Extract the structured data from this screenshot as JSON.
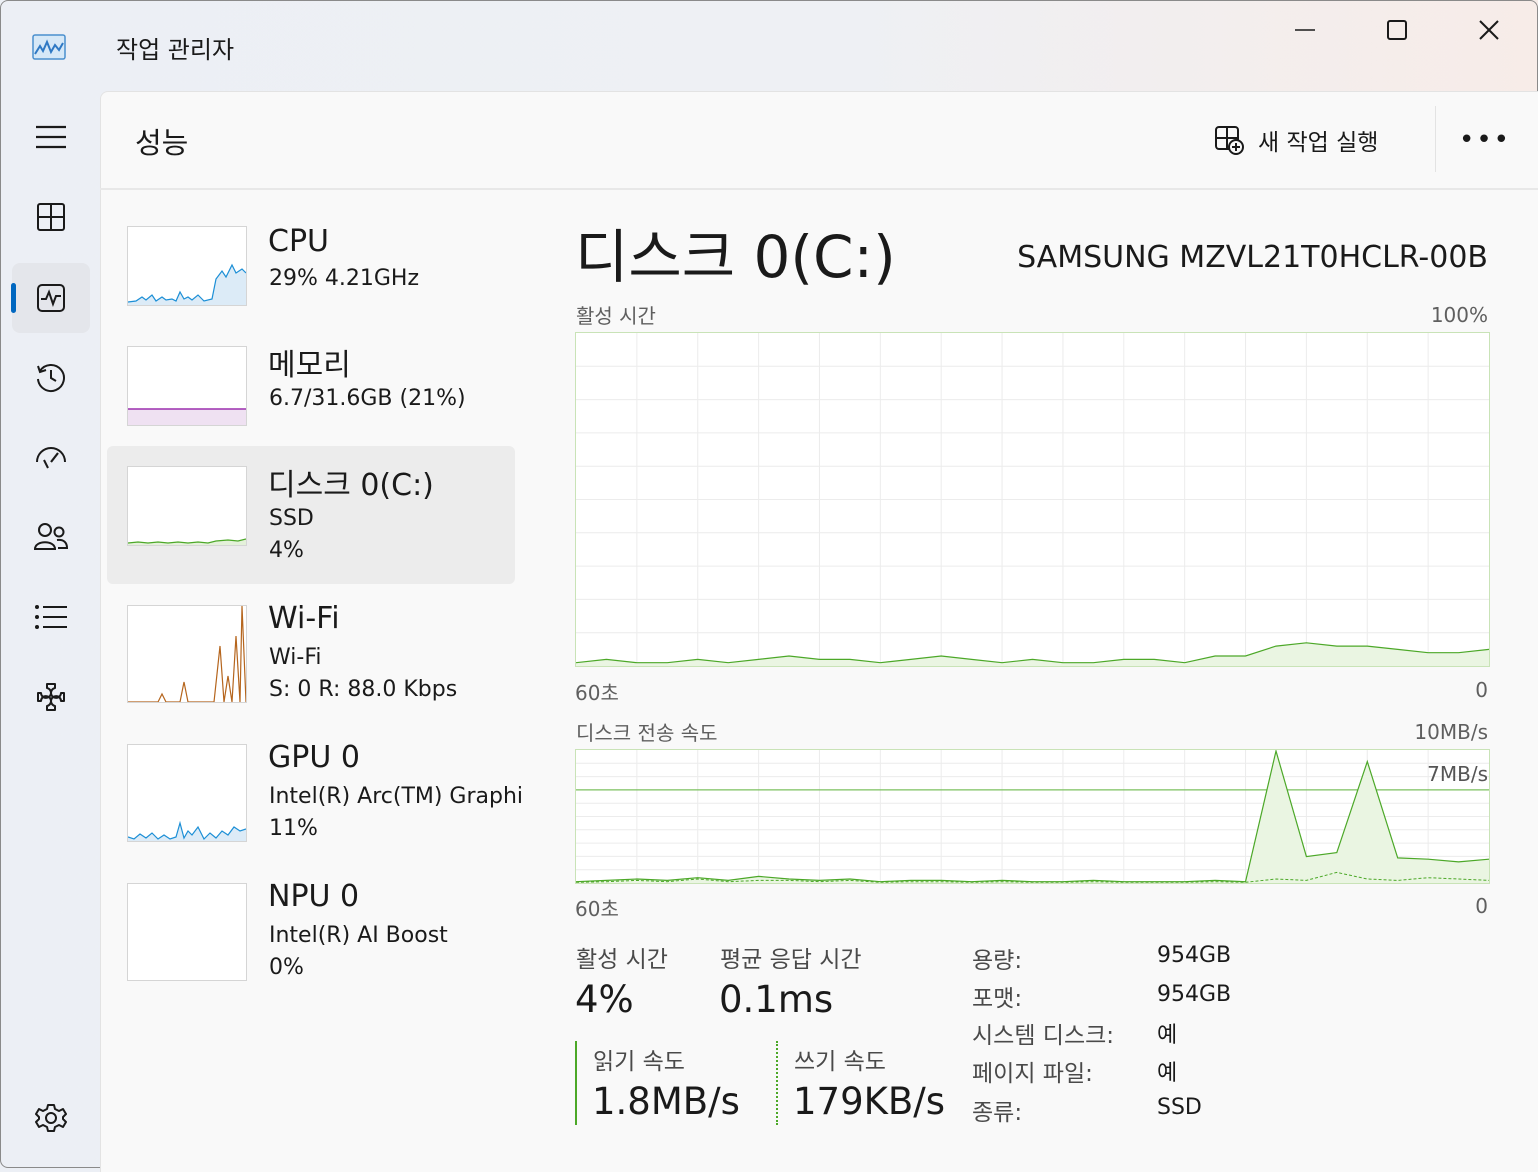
{
  "app": {
    "title": "작업 관리자"
  },
  "header": {
    "page_title": "성능",
    "run_task_label": "새 작업 실행",
    "more_label": "•••"
  },
  "nav": {
    "items": [
      {
        "name": "menu-icon"
      },
      {
        "name": "processes-icon"
      },
      {
        "name": "performance-icon",
        "active": true
      },
      {
        "name": "app-history-icon"
      },
      {
        "name": "startup-apps-icon"
      },
      {
        "name": "users-icon"
      },
      {
        "name": "details-icon"
      },
      {
        "name": "services-icon"
      },
      {
        "name": "settings-icon"
      }
    ]
  },
  "devices": [
    {
      "name": "CPU",
      "line1": "29%  4.21GHz",
      "line2": "",
      "color": "#1c8fd6"
    },
    {
      "name": "메모리",
      "line1": "6.7/31.6GB (21%)",
      "line2": "",
      "color": "#9b2fae"
    },
    {
      "name": "디스크 0(C:)",
      "line1": "SSD",
      "line2": "4%",
      "color": "#4ca828",
      "selected": true
    },
    {
      "name": "Wi-Fi",
      "line1": "Wi-Fi",
      "line2": "S: 0  R: 88.0 Kbps",
      "color": "#b5651d"
    },
    {
      "name": "GPU 0",
      "line1": "Intel(R) Arc(TM) Graphics",
      "line2": "11%",
      "color": "#1c8fd6"
    },
    {
      "name": "NPU 0",
      "line1": "Intel(R) AI Boost",
      "line2": "0%",
      "color": "#1c8fd6"
    }
  ],
  "detail": {
    "title": "디스크 0(C:)",
    "model": "SAMSUNG MZVL21T0HCLR-00B",
    "active_chart": {
      "label": "활성 시간",
      "max": "100%",
      "x_left": "60초",
      "x_right": "0"
    },
    "transfer_chart": {
      "label": "디스크 전송 속도",
      "max": "10MB/s",
      "line_label": "7MB/s",
      "x_left": "60초",
      "x_right": "0"
    },
    "stats": {
      "active_time_label": "활성 시간",
      "active_time_value": "4%",
      "response_label": "평균 응답 시간",
      "response_value": "0.1ms",
      "read_label": "읽기 속도",
      "read_value": "1.8MB/s",
      "write_label": "쓰기 속도",
      "write_value": "179KB/s"
    },
    "properties": [
      {
        "key": "용량:",
        "value": "954GB"
      },
      {
        "key": "포맷:",
        "value": "954GB"
      },
      {
        "key": "시스템 디스크:",
        "value": "예"
      },
      {
        "key": "페이지 파일:",
        "value": "예"
      },
      {
        "key": "종류:",
        "value": "SSD"
      }
    ]
  },
  "chart_data": [
    {
      "type": "area",
      "title": "활성 시간",
      "xlabel": "60초 → 0",
      "ylim": [
        0,
        100
      ],
      "x": [
        60,
        58,
        56,
        54,
        52,
        50,
        48,
        46,
        44,
        42,
        40,
        38,
        36,
        34,
        32,
        30,
        28,
        26,
        24,
        22,
        20,
        18,
        16,
        14,
        12,
        10,
        8,
        6,
        4,
        2,
        0
      ],
      "series": [
        {
          "values": [
            1,
            2,
            1,
            1,
            2,
            1,
            2,
            3,
            2,
            2,
            1,
            2,
            3,
            2,
            1,
            2,
            1,
            1,
            2,
            2,
            1,
            3,
            3,
            6,
            7,
            6,
            6,
            5,
            4,
            4,
            5
          ]
        }
      ]
    },
    {
      "type": "area",
      "title": "디스크 전송 속도",
      "xlabel": "60초 → 0",
      "ylim": [
        0,
        10
      ],
      "x": [
        60,
        58,
        56,
        54,
        52,
        50,
        48,
        46,
        44,
        42,
        40,
        38,
        36,
        34,
        32,
        30,
        28,
        26,
        24,
        22,
        20,
        18,
        16,
        14,
        12,
        10,
        8,
        6,
        4,
        2,
        0
      ],
      "series": [
        {
          "values": [
            0.1,
            0.2,
            0.3,
            0.2,
            0.4,
            0.2,
            0.5,
            0.3,
            0.2,
            0.3,
            0.1,
            0.2,
            0.2,
            0.1,
            0.2,
            0.1,
            0.1,
            0.2,
            0.1,
            0.1,
            0.1,
            0.2,
            0.1,
            10,
            2.0,
            2.3,
            9.2,
            1.9,
            1.8,
            1.6,
            1.8
          ]
        },
        {
          "values": [
            0.05,
            0.1,
            0.2,
            0.1,
            0.3,
            0.1,
            0.2,
            0.2,
            0.1,
            0.2,
            0.05,
            0.1,
            0.1,
            0.05,
            0.1,
            0.05,
            0.05,
            0.1,
            0.05,
            0.05,
            0.05,
            0.1,
            0.05,
            0.3,
            0.2,
            0.8,
            0.3,
            0.2,
            0.4,
            0.3,
            0.2
          ]
        }
      ]
    }
  ]
}
